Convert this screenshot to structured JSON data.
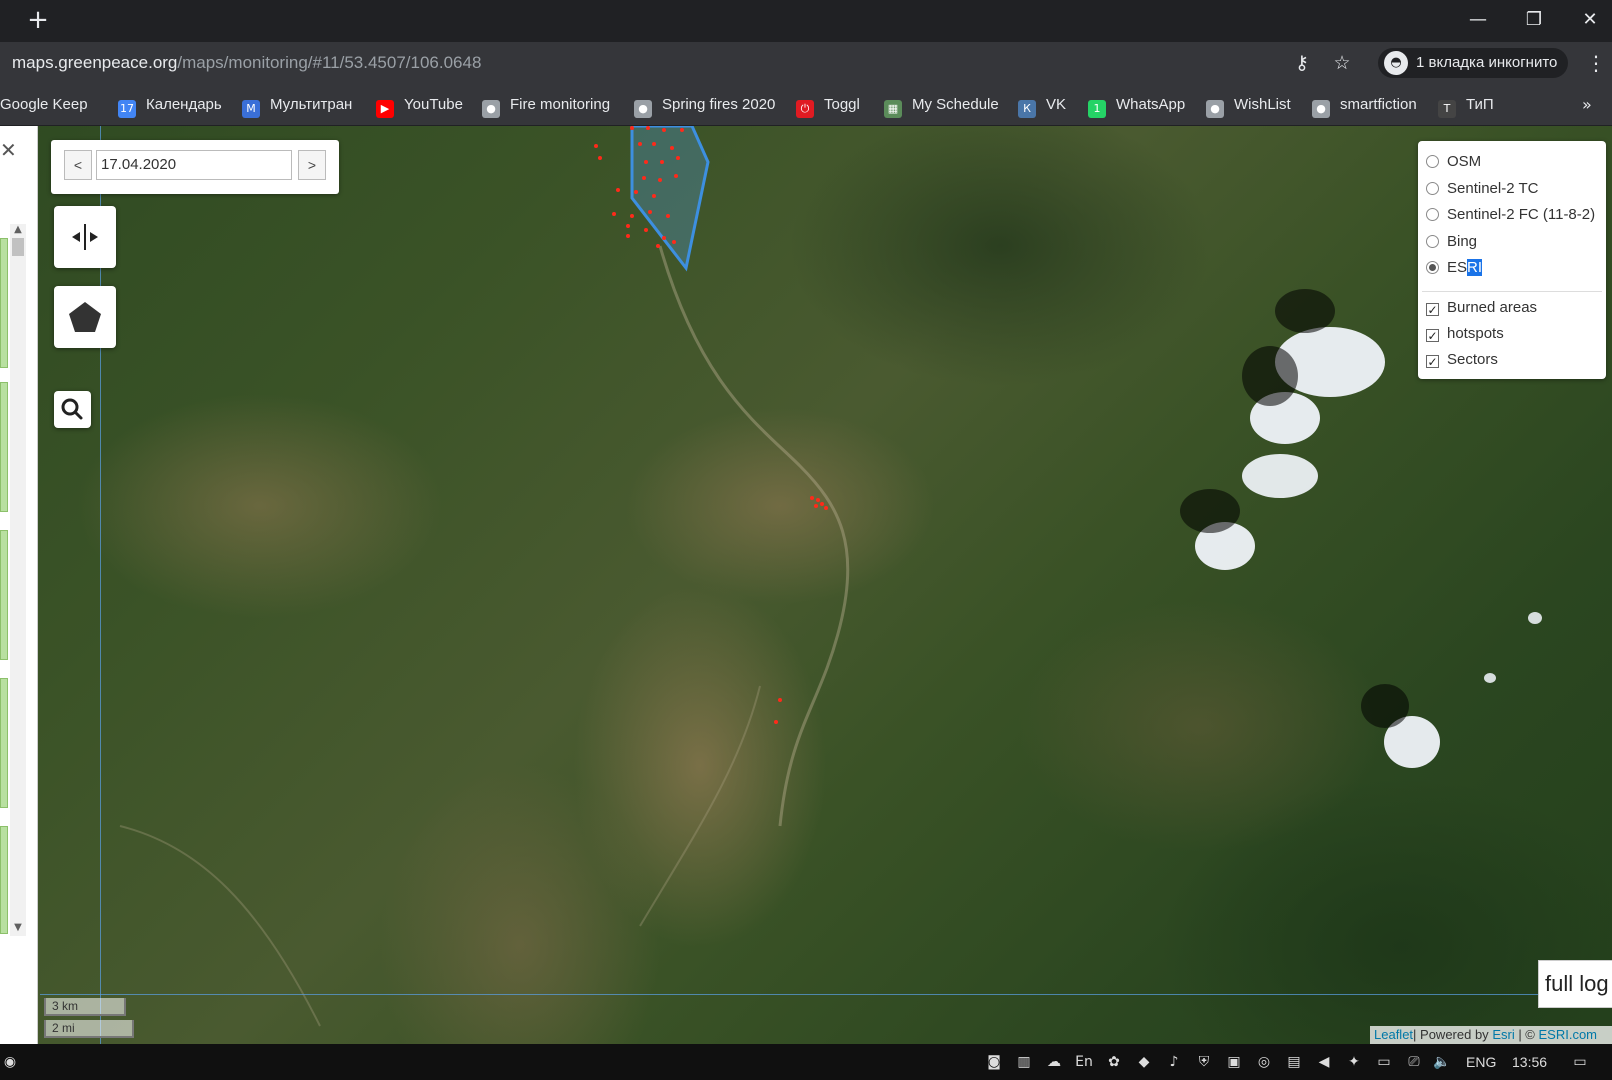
{
  "browser": {
    "new_tab_glyph": "+",
    "window_controls": {
      "minimize": "—",
      "restore": "❐",
      "close": "✕"
    },
    "url_host": "maps.greenpeace.org",
    "url_path": "/maps/monitoring/#11/53.4507/106.0648",
    "incognito_label": "1 вкладка инкогнито",
    "bookmarks": [
      {
        "label": "Google Keep",
        "icon": "keep-icon",
        "color": "#f4b400"
      },
      {
        "label": "Календарь",
        "icon": "calendar-icon",
        "color": "#4285f4",
        "glyph": "17"
      },
      {
        "label": "Мультитран",
        "icon": "multitran-icon",
        "color": "#3a6fd8",
        "glyph": "M"
      },
      {
        "label": "YouTube",
        "icon": "youtube-icon",
        "color": "#ff0000",
        "glyph": "▶"
      },
      {
        "label": "Fire monitoring",
        "icon": "globe-icon",
        "color": "#9aa0a6",
        "glyph": "●"
      },
      {
        "label": "Spring fires 2020",
        "icon": "globe-icon",
        "color": "#9aa0a6",
        "glyph": "●"
      },
      {
        "label": "Toggl",
        "icon": "toggl-icon",
        "color": "#e01b22",
        "glyph": "⏻"
      },
      {
        "label": "My Schedule",
        "icon": "schedule-icon",
        "color": "#5b8c5a",
        "glyph": "▦"
      },
      {
        "label": "VK",
        "icon": "vk-icon",
        "color": "#4a76a8",
        "glyph": "К"
      },
      {
        "label": "WhatsApp",
        "icon": "whatsapp-icon",
        "color": "#25d366",
        "glyph": "1"
      },
      {
        "label": "WishList",
        "icon": "globe-icon",
        "color": "#9aa0a6",
        "glyph": "●"
      },
      {
        "label": "smartfiction",
        "icon": "globe-icon",
        "color": "#9aa0a6",
        "glyph": "●"
      },
      {
        "label": "ТиП",
        "icon": "tip-icon",
        "color": "#444",
        "glyph": "Т"
      }
    ],
    "bookmarks_more": "»"
  },
  "date_panel": {
    "prev_label": "<",
    "date_value": "17.04.2020",
    "next_label": ">"
  },
  "map_controls": {
    "split_icon_glyph": "◂|▸",
    "search_icon_glyph": "⌕"
  },
  "layers": {
    "base": [
      {
        "label": "OSM",
        "checked": false
      },
      {
        "label": "Sentinel-2 TC",
        "checked": false
      },
      {
        "label": "Sentinel-2 FC (11-8-2)",
        "checked": false
      },
      {
        "label": "Bing",
        "checked": false
      },
      {
        "label_pre": "ES",
        "label_sel": "RI",
        "checked": true
      }
    ],
    "overlays": [
      {
        "label": "Burned areas",
        "checked": true
      },
      {
        "label": "hotspots",
        "checked": true
      },
      {
        "label": "Sectors",
        "checked": true
      }
    ]
  },
  "full_log_label": "full log",
  "scale": {
    "metric": "3 km",
    "imperial": "2 mi"
  },
  "attribution": {
    "leaflet": "Leaflet",
    "powered_by": "| Powered by ",
    "esri": "Esri",
    "copyright": " | © ",
    "esri_com": "ESRI.com"
  },
  "taskbar": {
    "language": "ENG",
    "time": "13:56"
  },
  "colors": {
    "polygon_stroke": "#3d8fe0",
    "hotspot": "#ff2a1a"
  }
}
